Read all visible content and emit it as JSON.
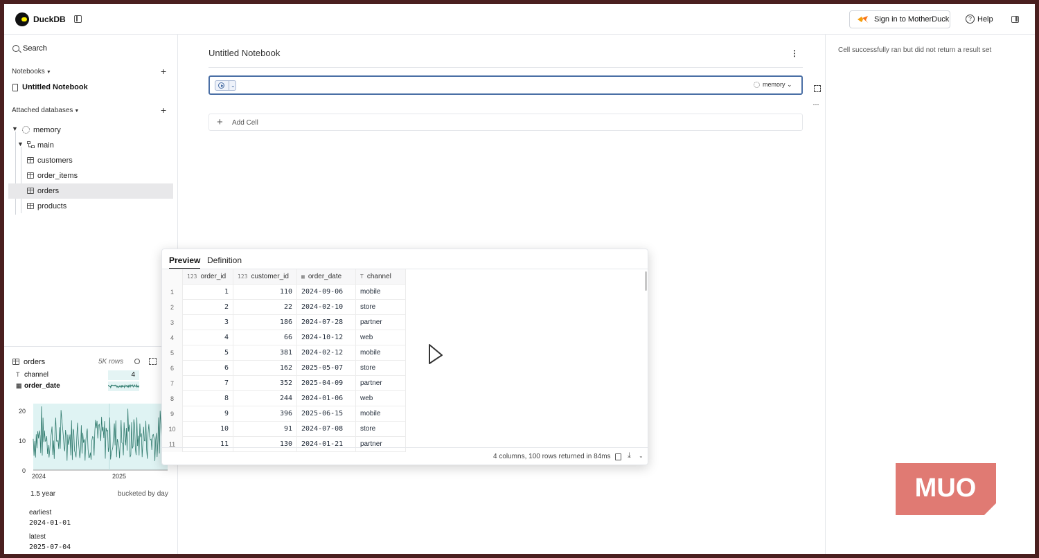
{
  "app": {
    "name": "DuckDB"
  },
  "header": {
    "signin_label": "Sign in to MotherDuck",
    "help_label": "Help"
  },
  "sidebar": {
    "search_label": "Search",
    "notebooks_label": "Notebooks",
    "notebook_item": "Untitled Notebook",
    "attached_label": "Attached databases",
    "tree": {
      "db": "memory",
      "schema": "main",
      "tables": [
        "customers",
        "order_items",
        "orders",
        "products"
      ]
    }
  },
  "summary": {
    "table_name": "orders",
    "row_count": "5K rows",
    "columns": [
      {
        "name": "channel",
        "icon": "text-type-icon",
        "count": "4"
      },
      {
        "name": "order_date",
        "icon": "calendar-type-icon"
      }
    ],
    "chart_data": {
      "type": "area",
      "title": "",
      "xlabel": "",
      "ylabel": "",
      "y_ticks": [
        "20",
        "10",
        "0"
      ],
      "x_ticks": [
        "2024",
        "2025"
      ],
      "ylim": [
        0,
        22
      ],
      "series_color": "#2f7a6d",
      "fill_color": "#dff3f3"
    },
    "span": "1.5 year",
    "bucket": "bucketed by day",
    "earliest_label": "earliest",
    "earliest_value": "2024-01-01",
    "latest_label": "latest",
    "latest_value": "2025-07-04"
  },
  "notebook": {
    "title": "Untitled Notebook",
    "cell_db": "memory",
    "add_cell_label": "Add Cell"
  },
  "right_panel": {
    "message": "Cell successfully ran but did not return a result set"
  },
  "preview": {
    "tabs": [
      "Preview",
      "Definition"
    ],
    "columns": [
      {
        "name": "order_id",
        "type": "123"
      },
      {
        "name": "customer_id",
        "type": "123"
      },
      {
        "name": "order_date",
        "type": "cal"
      },
      {
        "name": "channel",
        "type": "T"
      }
    ],
    "rows": [
      [
        "1",
        "1",
        "110",
        "2024-09-06",
        "mobile"
      ],
      [
        "2",
        "2",
        "22",
        "2024-02-10",
        "store"
      ],
      [
        "3",
        "3",
        "186",
        "2024-07-28",
        "partner"
      ],
      [
        "4",
        "4",
        "66",
        "2024-10-12",
        "web"
      ],
      [
        "5",
        "5",
        "381",
        "2024-02-12",
        "mobile"
      ],
      [
        "6",
        "6",
        "162",
        "2025-05-07",
        "store"
      ],
      [
        "7",
        "7",
        "352",
        "2025-04-09",
        "partner"
      ],
      [
        "8",
        "8",
        "244",
        "2024-01-06",
        "web"
      ],
      [
        "9",
        "9",
        "396",
        "2025-06-15",
        "mobile"
      ],
      [
        "10",
        "10",
        "91",
        "2024-07-08",
        "store"
      ],
      [
        "11",
        "11",
        "130",
        "2024-01-21",
        "partner"
      ]
    ],
    "footer": "4 columns, 100 rows returned in 84ms"
  },
  "watermark": {
    "text": "MUO",
    "color": "#e07a73"
  }
}
